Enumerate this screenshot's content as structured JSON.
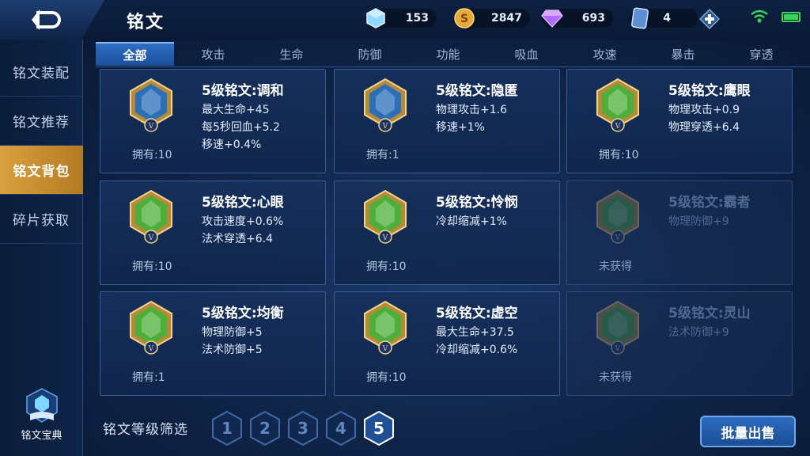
{
  "header": {
    "title": "铭文",
    "resources": [
      {
        "icon": "diamond-cube-icon",
        "value": "153"
      },
      {
        "icon": "gold-coin-icon",
        "value": "2847"
      },
      {
        "icon": "purple-crystal-icon",
        "value": "693"
      },
      {
        "icon": "card-ticket-icon",
        "value": "4"
      }
    ]
  },
  "sidebar": {
    "items": [
      {
        "label": "铭文装配"
      },
      {
        "label": "铭文推荐"
      },
      {
        "label": "铭文背包"
      },
      {
        "label": "碎片获取"
      }
    ],
    "active_index": 2,
    "bottom_label": "铭文宝典"
  },
  "tabs": [
    "全部",
    "攻击",
    "生命",
    "防御",
    "功能",
    "吸血",
    "攻速",
    "暴击",
    "穿透"
  ],
  "cards": [
    {
      "name": "5级铭文:调和",
      "attrs": [
        "最大生命+45",
        "每5秒回血+5.2",
        "移速+0.4%"
      ],
      "owned": "拥有:10",
      "locked": false,
      "emblem_color": "#2a6fb8"
    },
    {
      "name": "5级铭文:隐匿",
      "attrs": [
        "物理攻击+1.6",
        "移速+1%"
      ],
      "owned": "拥有:1",
      "locked": false,
      "emblem_color": "#2a6fb8"
    },
    {
      "name": "5级铭文:鹰眼",
      "attrs": [
        "物理攻击+0.9",
        "物理穿透+6.4"
      ],
      "owned": "拥有:10",
      "locked": false,
      "emblem_color": "#4caf3a"
    },
    {
      "name": "5级铭文:心眼",
      "attrs": [
        "攻击速度+0.6%",
        "法术穿透+6.4"
      ],
      "owned": "拥有:10",
      "locked": false,
      "emblem_color": "#4caf3a"
    },
    {
      "name": "5级铭文:怜悯",
      "attrs": [
        "冷却缩减+1%"
      ],
      "owned": "拥有:10",
      "locked": false,
      "emblem_color": "#4caf3a"
    },
    {
      "name": "5级铭文:霸者",
      "attrs": [
        "物理防御+9"
      ],
      "owned": "未获得",
      "locked": true,
      "emblem_color": "#4caf3a"
    },
    {
      "name": "5级铭文:均衡",
      "attrs": [
        "物理防御+5",
        "法术防御+5"
      ],
      "owned": "拥有:1",
      "locked": false,
      "emblem_color": "#4caf3a"
    },
    {
      "name": "5级铭文:虚空",
      "attrs": [
        "最大生命+37.5",
        "冷却缩减+0.6%"
      ],
      "owned": "拥有:10",
      "locked": false,
      "emblem_color": "#4caf3a"
    },
    {
      "name": "5级铭文:灵山",
      "attrs": [
        "法术防御+9"
      ],
      "owned": "未获得",
      "locked": true,
      "emblem_color": "#4caf3a"
    }
  ],
  "filter": {
    "label": "铭文等级筛选",
    "levels": [
      "1",
      "2",
      "3",
      "4",
      "5"
    ],
    "active_level": "5"
  },
  "sell_button": "批量出售"
}
